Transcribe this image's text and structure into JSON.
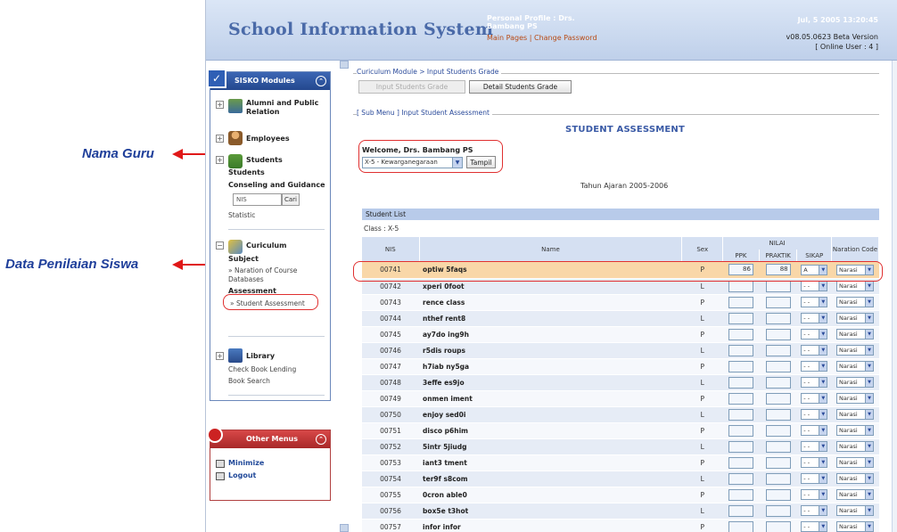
{
  "annotations": {
    "guru": "Nama Guru",
    "siswa": "Data Penilaian Siswa"
  },
  "header": {
    "title": "School Information System",
    "profile_title": "Personal Profile : Drs. Bambang PS",
    "main_pages": "Main Pages",
    "separator": "|",
    "change_password": "Change Password",
    "date": "Jul, 5 2005 13:20:45",
    "version": "v08.05.0623 Beta Version",
    "online": "[ Online User : 4 ]"
  },
  "sidebar": {
    "modules_title": "SISKO Modules",
    "alumni": "Alumni and Public Relation",
    "employees": "Employees",
    "students": "Students",
    "students_sub": "Students",
    "conseling": "Conseling and Guidance",
    "nis_placeholder": "NIS",
    "cari": "Cari",
    "statistic": "Statistic",
    "curiculum": "Curiculum",
    "subject": "Subject",
    "narration": "» Naration of Course",
    "databases": "Databases",
    "assessment": "Assessment",
    "student_assessment": "» Student Assessment",
    "library": "Library",
    "check_book": "Check Book Lending",
    "book_search": "Book Search",
    "other_title": "Other Menus",
    "minimize": "Minimize",
    "logout": "Logout"
  },
  "main": {
    "legend1": "Curiculum Module > Input Students Grade",
    "btn_input": "Input Students Grade",
    "btn_detail": "Detail Students Grade",
    "legend2": "[ Sub Menu ] Input Student Assessment",
    "heading": "STUDENT ASSESSMENT",
    "welcome": "Welcome, Drs. Bambang PS",
    "class_select": "X-5 - Kewarganegaraan",
    "tampil": "Tampil",
    "tahun": "Tahun Ajaran 2005-2006",
    "student_list": "Student List",
    "class": "Class : X-5",
    "columns": {
      "nis": "NIS",
      "name": "Name",
      "sex": "Sex",
      "nilai": "NILAI",
      "ppk": "PPK",
      "praktik": "PRAKTIK",
      "sikap": "SIKAP",
      "naration": "Naration Code"
    }
  },
  "students": [
    {
      "nis": "00741",
      "name": "optiw 5faqs",
      "sex": "P",
      "ppk": "86",
      "praktik": "88",
      "sikap": "A",
      "naration": "Narasi"
    },
    {
      "nis": "00742",
      "name": "xperi 0foot",
      "sex": "L",
      "ppk": "",
      "praktik": "",
      "sikap": "- -",
      "naration": "Narasi"
    },
    {
      "nis": "00743",
      "name": "rence class",
      "sex": "P",
      "ppk": "",
      "praktik": "",
      "sikap": "- -",
      "naration": "Narasi"
    },
    {
      "nis": "00744",
      "name": "nthef rent8",
      "sex": "L",
      "ppk": "",
      "praktik": "",
      "sikap": "- -",
      "naration": "Narasi"
    },
    {
      "nis": "00745",
      "name": "ay7do ing9h",
      "sex": "P",
      "ppk": "",
      "praktik": "",
      "sikap": "- -",
      "naration": "Narasi"
    },
    {
      "nis": "00746",
      "name": "r5dis roups",
      "sex": "L",
      "ppk": "",
      "praktik": "",
      "sikap": "- -",
      "naration": "Narasi"
    },
    {
      "nis": "00747",
      "name": "h7iab ny5ga",
      "sex": "P",
      "ppk": "",
      "praktik": "",
      "sikap": "- -",
      "naration": "Narasi"
    },
    {
      "nis": "00748",
      "name": "3effe es9jo",
      "sex": "L",
      "ppk": "",
      "praktik": "",
      "sikap": "- -",
      "naration": "Narasi"
    },
    {
      "nis": "00749",
      "name": "onmen iment",
      "sex": "P",
      "ppk": "",
      "praktik": "",
      "sikap": "- -",
      "naration": "Narasi"
    },
    {
      "nis": "00750",
      "name": "enjoy sed0i",
      "sex": "L",
      "ppk": "",
      "praktik": "",
      "sikap": "- -",
      "naration": "Narasi"
    },
    {
      "nis": "00751",
      "name": "disco p6him",
      "sex": "P",
      "ppk": "",
      "praktik": "",
      "sikap": "- -",
      "naration": "Narasi"
    },
    {
      "nis": "00752",
      "name": "5intr 5jiudg",
      "sex": "L",
      "ppk": "",
      "praktik": "",
      "sikap": "- -",
      "naration": "Narasi"
    },
    {
      "nis": "00753",
      "name": "iant3 tment",
      "sex": "P",
      "ppk": "",
      "praktik": "",
      "sikap": "- -",
      "naration": "Narasi"
    },
    {
      "nis": "00754",
      "name": "ter9f s8com",
      "sex": "L",
      "ppk": "",
      "praktik": "",
      "sikap": "- -",
      "naration": "Narasi"
    },
    {
      "nis": "00755",
      "name": "0cron able0",
      "sex": "P",
      "ppk": "",
      "praktik": "",
      "sikap": "- -",
      "naration": "Narasi"
    },
    {
      "nis": "00756",
      "name": "box5e t3hot",
      "sex": "L",
      "ppk": "",
      "praktik": "",
      "sikap": "- -",
      "naration": "Narasi"
    },
    {
      "nis": "00757",
      "name": "infor infor",
      "sex": "P",
      "ppk": "",
      "praktik": "",
      "sikap": "- -",
      "naration": "Narasi"
    }
  ]
}
